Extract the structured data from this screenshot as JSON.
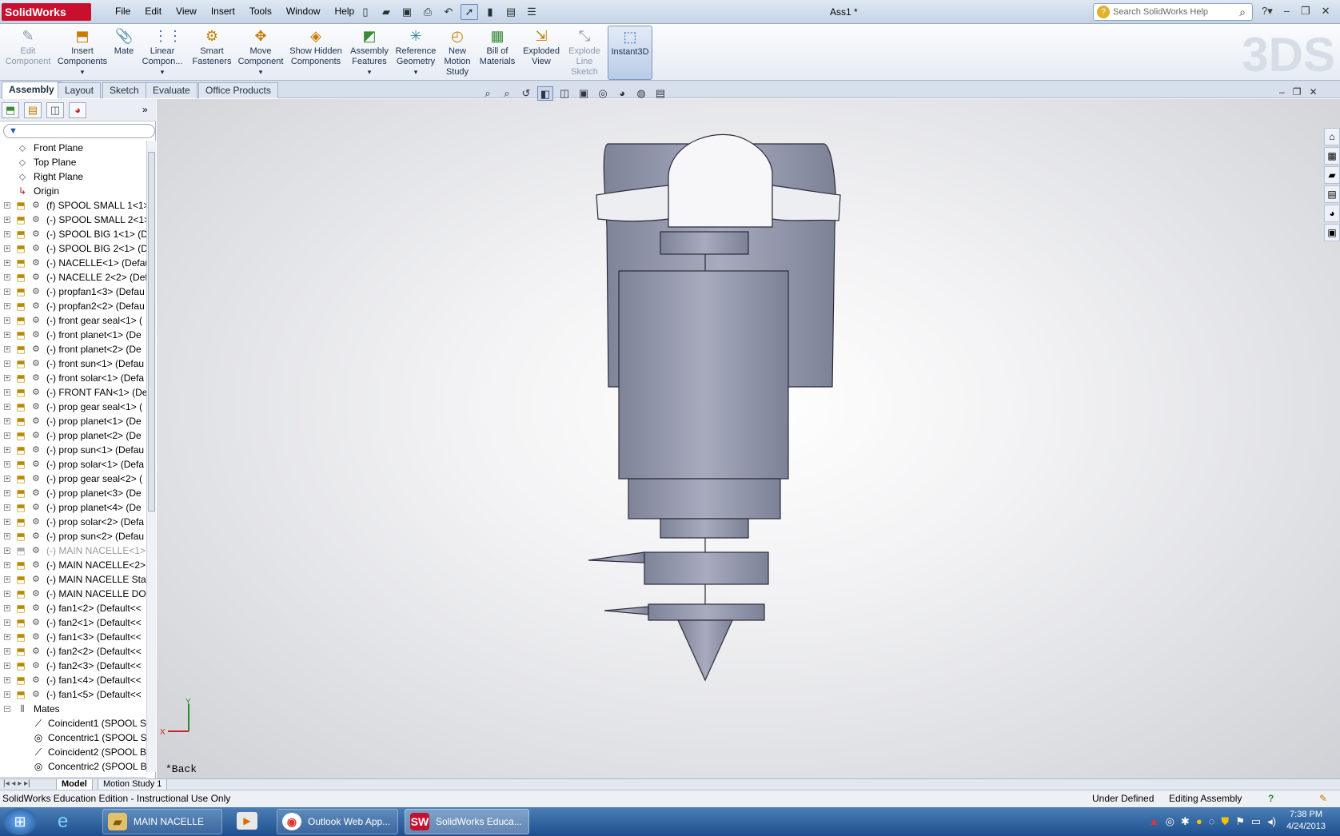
{
  "app": {
    "logo": "SolidWorks",
    "document_title": "Ass1 *"
  },
  "menu": [
    "File",
    "Edit",
    "View",
    "Insert",
    "Tools",
    "Window",
    "Help"
  ],
  "search": {
    "placeholder": "Search SolidWorks Help"
  },
  "ribbon": [
    {
      "label": "Edit Component",
      "icon": "edit-component-icon",
      "enabled": false
    },
    {
      "label": "Insert Components",
      "icon": "insert-components-icon",
      "enabled": true
    },
    {
      "label": "Mate",
      "icon": "mate-icon",
      "enabled": true
    },
    {
      "label": "Linear Compon...",
      "icon": "linear-pattern-icon",
      "enabled": true
    },
    {
      "label": "Smart Fasteners",
      "icon": "smart-fasteners-icon",
      "enabled": true
    },
    {
      "label": "Move Component",
      "icon": "move-component-icon",
      "enabled": true
    },
    {
      "label": "Show Hidden Components",
      "icon": "show-hidden-icon",
      "enabled": true
    },
    {
      "label": "Assembly Features",
      "icon": "assembly-features-icon",
      "enabled": true
    },
    {
      "label": "Reference Geometry",
      "icon": "reference-geometry-icon",
      "enabled": true
    },
    {
      "label": "New Motion Study",
      "icon": "motion-study-icon",
      "enabled": true
    },
    {
      "label": "Bill of Materials",
      "icon": "bom-icon",
      "enabled": true
    },
    {
      "label": "Exploded View",
      "icon": "exploded-view-icon",
      "enabled": true
    },
    {
      "label": "Explode Line Sketch",
      "icon": "explode-line-icon",
      "enabled": false
    },
    {
      "label": "Instant3D",
      "icon": "instant3d-icon",
      "enabled": true,
      "active": true
    }
  ],
  "tabs": [
    "Assembly",
    "Layout",
    "Sketch",
    "Evaluate",
    "Office Products"
  ],
  "tree": {
    "planes": [
      "Front Plane",
      "Top Plane",
      "Right Plane",
      "Origin"
    ],
    "components": [
      "(f) SPOOL SMALL 1<1>",
      "(-) SPOOL SMALL 2<1>",
      "(-) SPOOL BIG 1<1> (D",
      "(-) SPOOL BIG 2<1> (D",
      "(-) NACELLE<1> (Defau",
      "(-) NACELLE 2<2> (Def",
      "(-) propfan1<3> (Defau",
      "(-) propfan2<2> (Defau",
      "(-) front gear seal<1> (",
      "(-) front planet<1> (De",
      "(-) front planet<2> (De",
      "(-) front sun<1> (Defau",
      "(-) front solar<1> (Defa",
      "(-) FRONT FAN<1> (De",
      "(-) prop gear seal<1> (",
      "(-) prop planet<1> (De",
      "(-) prop planet<2> (De",
      "(-) prop sun<1> (Defau",
      "(-) prop solar<1> (Defa",
      "(-) prop gear seal<2> (",
      "(-) prop planet<3> (De",
      "(-) prop planet<4> (De",
      "(-) prop solar<2> (Defa",
      "(-) prop sun<2> (Defau",
      "(-) MAIN NACELLE<1> (D",
      "(-) MAIN NACELLE<2> (",
      "(-) MAIN NACELLE Star",
      "(-) MAIN NACELLE DO(",
      "(-) fan1<2> (Default<<",
      "(-) fan2<1> (Default<<",
      "(-) fan1<3> (Default<<",
      "(-) fan2<2> (Default<<",
      "(-) fan2<3> (Default<<",
      "(-) fan1<4> (Default<<",
      "(-) fan1<5> (Default<<"
    ],
    "mates_label": "Mates",
    "mates": [
      "Coincident1 (SPOOL SI",
      "Concentric1 (SPOOL SI",
      "Coincident2 (SPOOL B",
      "Concentric2 (SPOOL B"
    ]
  },
  "viewport": {
    "view_name": "*Back",
    "triad_x": "X",
    "triad_y": "Y"
  },
  "bottom_tabs": [
    "Model",
    "Motion Study 1"
  ],
  "status": {
    "left": "SolidWorks Education Edition - Instructional Use Only",
    "state": "Under Defined",
    "mode": "Editing Assembly"
  },
  "taskbar": {
    "items": [
      "MAIN NACELLE",
      "Outlook Web App...",
      "SolidWorks Educa..."
    ],
    "time": "7:38 PM",
    "date": "4/24/2013"
  },
  "colors": {
    "accent": "#c8102e",
    "model_body": "#8f93a8",
    "model_light": "#b9bccb"
  }
}
